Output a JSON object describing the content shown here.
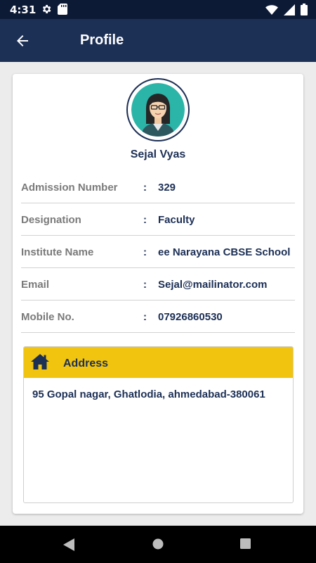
{
  "status_bar": {
    "time": "4:31",
    "left_icons": [
      "gear-icon",
      "sd-card-icon"
    ],
    "right_icons": [
      "wifi-icon",
      "signal-icon",
      "battery-icon"
    ]
  },
  "app_bar": {
    "title": "Profile",
    "background": "#1c2f55"
  },
  "profile": {
    "name": "Sejal Vyas",
    "rows": [
      {
        "label": "Admission Number",
        "value": "329"
      },
      {
        "label": "Designation",
        "value": "Faculty"
      },
      {
        "label": "Institute Name",
        "value": "ee Narayana CBSE School"
      },
      {
        "label": "Email",
        "value": "Sejal@mailinator.com"
      },
      {
        "label": "Mobile No.",
        "value": "07926860530"
      }
    ],
    "separator": ":"
  },
  "address": {
    "title": "Address",
    "text": "95 Gopal nagar, Ghatlodia, ahmedabad-380061",
    "header_color": "#f1c40f"
  },
  "nav_bar": {
    "buttons": [
      "back-triangle-icon",
      "home-circle-icon",
      "recents-square-icon"
    ]
  }
}
